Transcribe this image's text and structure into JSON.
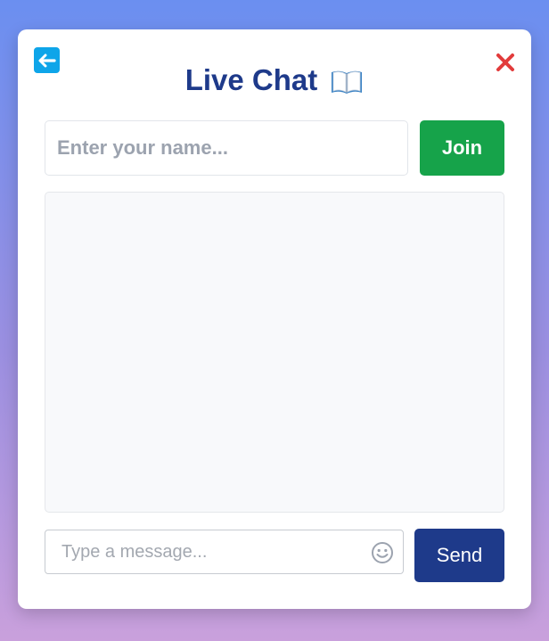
{
  "header": {
    "title": "Live Chat",
    "back_icon": "arrow-left-icon",
    "close_icon": "close-icon",
    "title_icon": "open-book-icon"
  },
  "join": {
    "name_placeholder": "Enter your name...",
    "name_value": "",
    "join_label": "Join"
  },
  "messages": {
    "items": []
  },
  "composer": {
    "message_placeholder": "Type a message...",
    "message_value": "",
    "emoji_icon": "smiley-icon",
    "send_label": "Send"
  },
  "colors": {
    "accent_navy": "#1e3a8a",
    "join_green": "#16a34a",
    "back_blue": "#0ea5e9",
    "close_red": "#e23b3b"
  }
}
